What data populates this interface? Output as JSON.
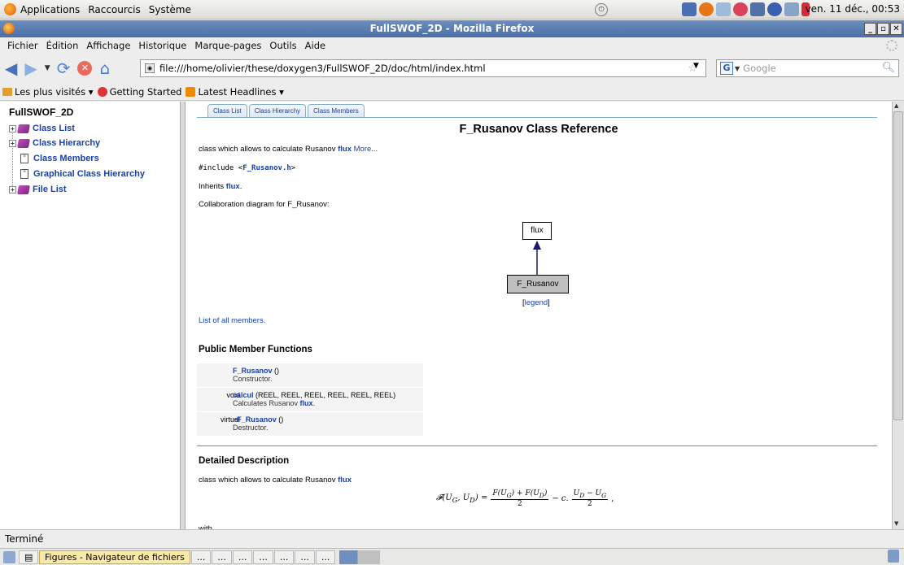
{
  "panel": {
    "menus": [
      "Applications",
      "Raccourcis",
      "Système"
    ],
    "clock": "ven. 11 déc., 00:53"
  },
  "window": {
    "title": "FullSWOF_2D - Mozilla Firefox"
  },
  "menubar": [
    "Fichier",
    "Édition",
    "Affichage",
    "Historique",
    "Marque-pages",
    "Outils",
    "Aide"
  ],
  "navbar": {
    "url": "file:///home/olivier/these/doxygen3/FullSWOF_2D/doc/html/index.html",
    "search_placeholder": "Google"
  },
  "bookmarks": [
    "Les plus visités ▾",
    "Getting Started",
    "Latest Headlines ▾"
  ],
  "sidebar": {
    "title": "FullSWOF_2D",
    "items": [
      {
        "label": "Class List"
      },
      {
        "label": "Class Hierarchy"
      },
      {
        "label": "Class Members"
      },
      {
        "label": "Graphical Class Hierarchy"
      },
      {
        "label": "File List"
      }
    ]
  },
  "content": {
    "tabs": [
      "Class List",
      "Class Hierarchy",
      "Class Members"
    ],
    "title": "F_Rusanov Class Reference",
    "brief": "class which allows to calculate Rusanov",
    "brief_link": "flux",
    "more": "More...",
    "include": "#include <",
    "include_file": "F_Rusanov.h",
    "include_close": ">",
    "inherits": "Inherits",
    "inherits_link": "flux",
    "inherits_end": ".",
    "collab": "Collaboration diagram for F_Rusanov:",
    "diagram": {
      "parent": "flux",
      "child": "F_Rusanov",
      "legend": "legend"
    },
    "all_members": "List of all members.",
    "public_header": "Public Member Functions",
    "members": [
      {
        "ret": "",
        "name": "F_Rusanov",
        "args": " ()",
        "desc": "Constructor.",
        "desc_link": ""
      },
      {
        "ret": "void",
        "name": "calcul",
        "args": " (REEL, REEL, REEL, REEL, REEL, REEL)",
        "desc": "Calculates Rusanov ",
        "desc_link": "flux"
      },
      {
        "ret": "virtual",
        "name": "~F_Rusanov",
        "args": " ()",
        "desc": "Destructor.",
        "desc_link": ""
      }
    ],
    "detail_header": "Detailed Description",
    "detail_text": "class which allows to calculate Rusanov",
    "detail_link": "flux",
    "with": "with"
  },
  "status": "Terminé",
  "taskbar": [
    "Figures - Navigateur de fichiers",
    "...",
    "...",
    "...",
    "...",
    "...",
    "...",
    "..."
  ]
}
